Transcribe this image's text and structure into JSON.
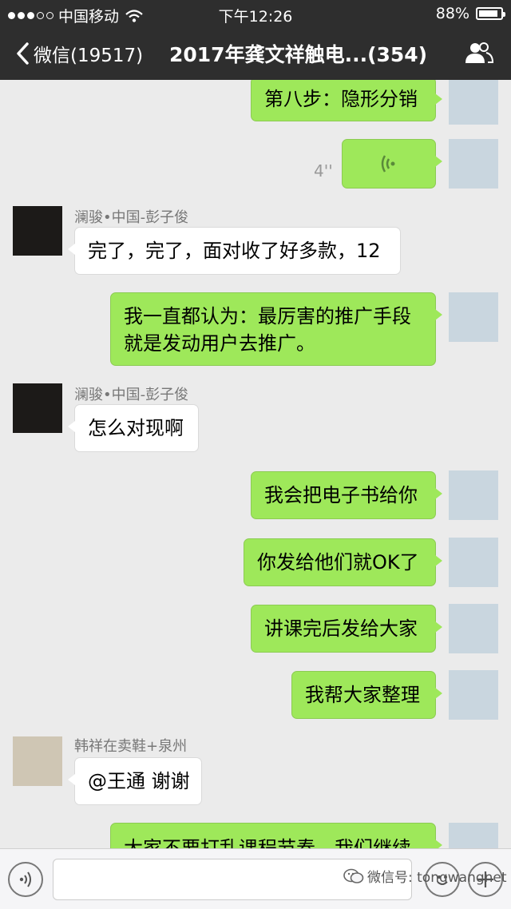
{
  "status_bar": {
    "carrier": "中国移动",
    "time": "下午12:26",
    "battery": "88%",
    "battery_level": 0.88
  },
  "nav": {
    "back_label": "微信(19517)",
    "title": "2017年龚文祥触电...(354)"
  },
  "messages": [
    {
      "text": "第八步：隐形分销"
    },
    {
      "duration": "4''"
    },
    {
      "sender": "澜骏•中国-彭子俊",
      "text": "完了，完了，面对收了好多款，12"
    },
    {
      "line1": "我一直都认为：最厉害的推广手段",
      "line2": "就是发动用户去推广。"
    },
    {
      "sender": "澜骏•中国-彭子俊",
      "text": "怎么对现啊"
    },
    {
      "text": "我会把电子书给你"
    },
    {
      "text": "你发给他们就OK了"
    },
    {
      "text": "讲课完后发给大家"
    },
    {
      "text": "我帮大家整理"
    },
    {
      "sender": "韩祥在卖鞋+泉州",
      "text": "@王通 谢谢"
    },
    {
      "text": "大家不要打乱课程节奏，我们继续"
    }
  ],
  "watermark": "微信号: tongwangnet",
  "colors": {
    "bar": "#2e2e2e",
    "outgoing": "#9ee85a",
    "incoming": "#ffffff",
    "chat_bg": "#ebebeb"
  },
  "icons": [
    "signal-icon",
    "wifi-icon",
    "battery-icon",
    "back-chevron-icon",
    "group-info-icon",
    "voice-wave-icon",
    "voice-mode-icon",
    "emoji-icon",
    "plus-icon",
    "wechat-logo-icon"
  ]
}
